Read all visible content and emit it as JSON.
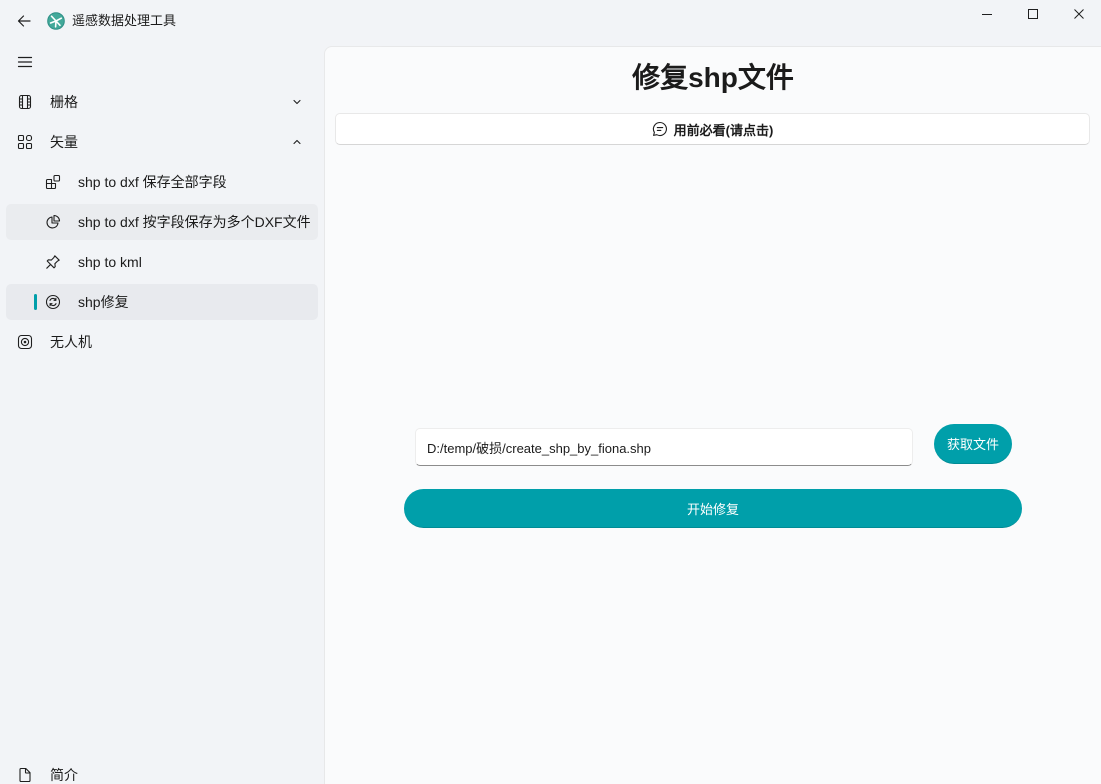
{
  "window": {
    "title": "遥感数据处理工具",
    "back_icon": "arrow-left-icon",
    "app_icon": "app-logo-icon",
    "controls": [
      "minimize-icon",
      "maximize-icon",
      "close-icon"
    ]
  },
  "theme": {
    "accent": "#009faa",
    "nav_background": "#f2f4f7",
    "content_background": "#fafbfc",
    "selected_background": "#e8eaee"
  },
  "nav": {
    "menu_icon": "hamburger-menu-icon",
    "items": [
      {
        "label": "栅格",
        "icon": "filmstrip-icon",
        "expanded": false,
        "chevron": "chevron-down-icon"
      },
      {
        "label": "矢量",
        "icon": "apps-icon",
        "expanded": true,
        "chevron": "chevron-up-icon",
        "children": [
          {
            "label": "shp to dxf 保存全部字段",
            "icon": "apps-add-in-icon",
            "selected": false,
            "hovered": false
          },
          {
            "label": "shp to dxf 按字段保存为多个DXF文件",
            "icon": "pie-chart-icon",
            "selected": false,
            "hovered": true
          },
          {
            "label": "shp to kml",
            "icon": "pin-icon",
            "selected": false,
            "hovered": false
          },
          {
            "label": "shp修复",
            "icon": "arrow-sync-circle-icon",
            "selected": true,
            "hovered": false
          }
        ]
      },
      {
        "label": "无人机",
        "icon": "target-icon"
      }
    ],
    "footer_items": [
      {
        "label": "简介",
        "icon": "document-icon"
      }
    ]
  },
  "page": {
    "title": "修复shp文件",
    "notice_button": {
      "label": "用前必看(请点击)",
      "icon": "chat-icon"
    },
    "file_path": {
      "value": "D:/temp/破损/create_shp_by_fiona.shp"
    },
    "browse_button": {
      "label": "获取文件"
    },
    "start_button": {
      "label": "开始修复"
    }
  }
}
